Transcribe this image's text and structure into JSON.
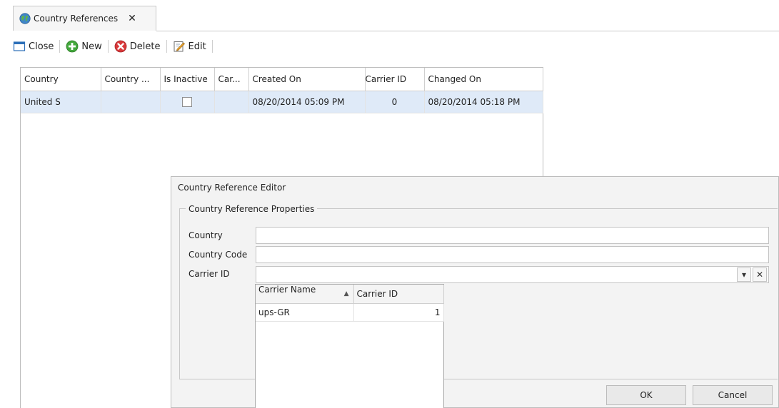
{
  "tab": {
    "title": "Country References",
    "close_glyph": "✕",
    "icon": "globe-icon"
  },
  "toolbar": {
    "close_label": "Close",
    "new_label": "New",
    "delete_label": "Delete",
    "edit_label": "Edit"
  },
  "grid": {
    "columns": [
      "Country",
      "Country ...",
      "Is Inactive",
      "Car...",
      "Created On",
      "Carrier ID",
      "Changed On"
    ],
    "rows": [
      {
        "country": "United S",
        "country_code": "",
        "is_inactive": false,
        "carrier": "",
        "created_on": "08/20/2014 05:09 PM",
        "carrier_id": "0",
        "changed_on": "08/20/2014 05:18 PM"
      }
    ]
  },
  "dialog": {
    "title": "Country Reference Editor",
    "group_title": "Country Reference Properties",
    "country_label": "Country",
    "country_value": "",
    "country_code_label": "Country Code",
    "country_code_value": "",
    "carrier_id_label": "Carrier ID",
    "carrier_id_value": "",
    "dropdown_glyph": "▾",
    "clear_glyph": "✕",
    "ok_label": "OK",
    "cancel_label": "Cancel"
  },
  "popup": {
    "columns": [
      "Carrier Name",
      "Carrier ID"
    ],
    "sort_glyph": "▲",
    "rows": [
      {
        "carrier_name": "ups-GR",
        "carrier_id": "1"
      }
    ]
  },
  "colors": {
    "selected_row": "#dfeaf8",
    "dialog_bg": "#f3f3f3",
    "button_bg": "#e9e9e9"
  }
}
